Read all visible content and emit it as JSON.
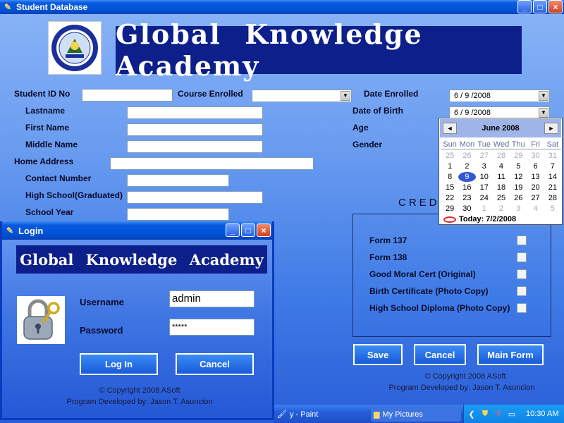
{
  "main": {
    "title": "Student Database",
    "banner": "Global Knowledge Academy",
    "labels": {
      "student_id": "Student ID No",
      "course": "Course Enrolled",
      "date_enrolled": "Date Enrolled",
      "lastname": "Lastname",
      "dob": "Date of Birth",
      "firstname": "First Name",
      "age": "Age",
      "middlename": "Middle Name",
      "gender": "Gender",
      "address": "Home Address",
      "contact": "Contact Number",
      "highschool": "High School(Graduated)",
      "school_year": "School Year"
    },
    "date_enrolled_value": "6 / 9 /2008",
    "dob_value": "6 / 9 /2008",
    "credentials_title": "CRED",
    "credentials": [
      "Form 137",
      "Form 138",
      "Good Moral Cert (Original)",
      "Birth Certificate (Photo Copy)",
      "High School Diploma (Photo Copy)"
    ],
    "buttons": {
      "save": "Save",
      "cancel": "Cancel",
      "main_form": "Main Form"
    },
    "footer": {
      "copyright": "© Copyright 2008 ASoft",
      "developer": "Program Developed by: Jason T. Asuncion"
    }
  },
  "calendar": {
    "month": "June 2008",
    "dow": [
      "Sun",
      "Mon",
      "Tue",
      "Wed",
      "Thu",
      "Fri",
      "Sat"
    ],
    "weeks": [
      [
        "25",
        "26",
        "27",
        "28",
        "29",
        "30",
        "31"
      ],
      [
        "1",
        "2",
        "3",
        "4",
        "5",
        "6",
        "7"
      ],
      [
        "8",
        "9",
        "10",
        "11",
        "12",
        "13",
        "14"
      ],
      [
        "15",
        "16",
        "17",
        "18",
        "19",
        "20",
        "21"
      ],
      [
        "22",
        "23",
        "24",
        "25",
        "26",
        "27",
        "28"
      ],
      [
        "29",
        "30",
        "1",
        "2",
        "3",
        "4",
        "5"
      ]
    ],
    "selected": "9",
    "today_label": "Today: 7/2/2008"
  },
  "login": {
    "title": "Login",
    "banner": "Global Knowledge Academy",
    "username_label": "Username",
    "username_value": "admin",
    "password_label": "Password",
    "password_value": "*****",
    "login_button": "Log In",
    "cancel_button": "Cancel",
    "copyright": "© Copyright 2008 ASoft",
    "developer": "Program Developed by: Jason T. Asuncion"
  },
  "taskbar": {
    "items": [
      "y - Paint",
      "My Pictures"
    ],
    "clock": "10:30 AM"
  }
}
